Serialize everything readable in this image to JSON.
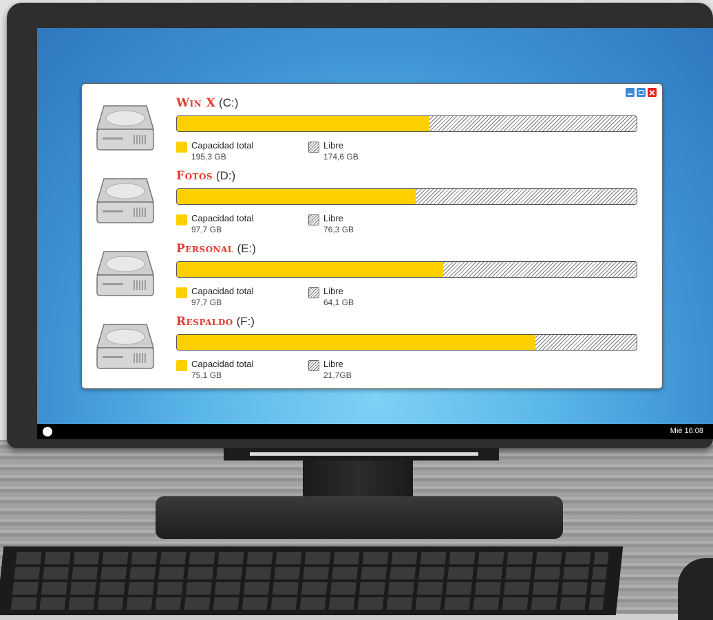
{
  "window": {
    "controls": [
      "minimize",
      "maximize",
      "close"
    ]
  },
  "drives": [
    {
      "name": "Win X",
      "letter": "(C:)",
      "total_label": "Capacidad total",
      "total": "195,3 GB",
      "free_label": "Libre",
      "free": "174,6 GB",
      "used_fraction": 0.55
    },
    {
      "name": "Fotos",
      "letter": "(D:)",
      "total_label": "Capacidad total",
      "total": "97,7 GB",
      "free_label": "Libre",
      "free": "76,3 GB",
      "used_fraction": 0.52
    },
    {
      "name": "Personal",
      "letter": "(E:)",
      "total_label": "Capacidad total",
      "total": "97,7 GB",
      "free_label": "Libre",
      "free": "64,1 GB",
      "used_fraction": 0.58
    },
    {
      "name": "Respaldo",
      "letter": "(F:)",
      "total_label": "Capacidad total",
      "total": "75,1 GB",
      "free_label": "Libre",
      "free": "21,7GB",
      "used_fraction": 0.78
    }
  ],
  "taskbar": {
    "clock": "Mié 16:08",
    "start_icon": "circle-icon"
  },
  "colors": {
    "used": "#ffd000",
    "brand_title": "#e23a2e",
    "screen": "#4aa6df"
  }
}
